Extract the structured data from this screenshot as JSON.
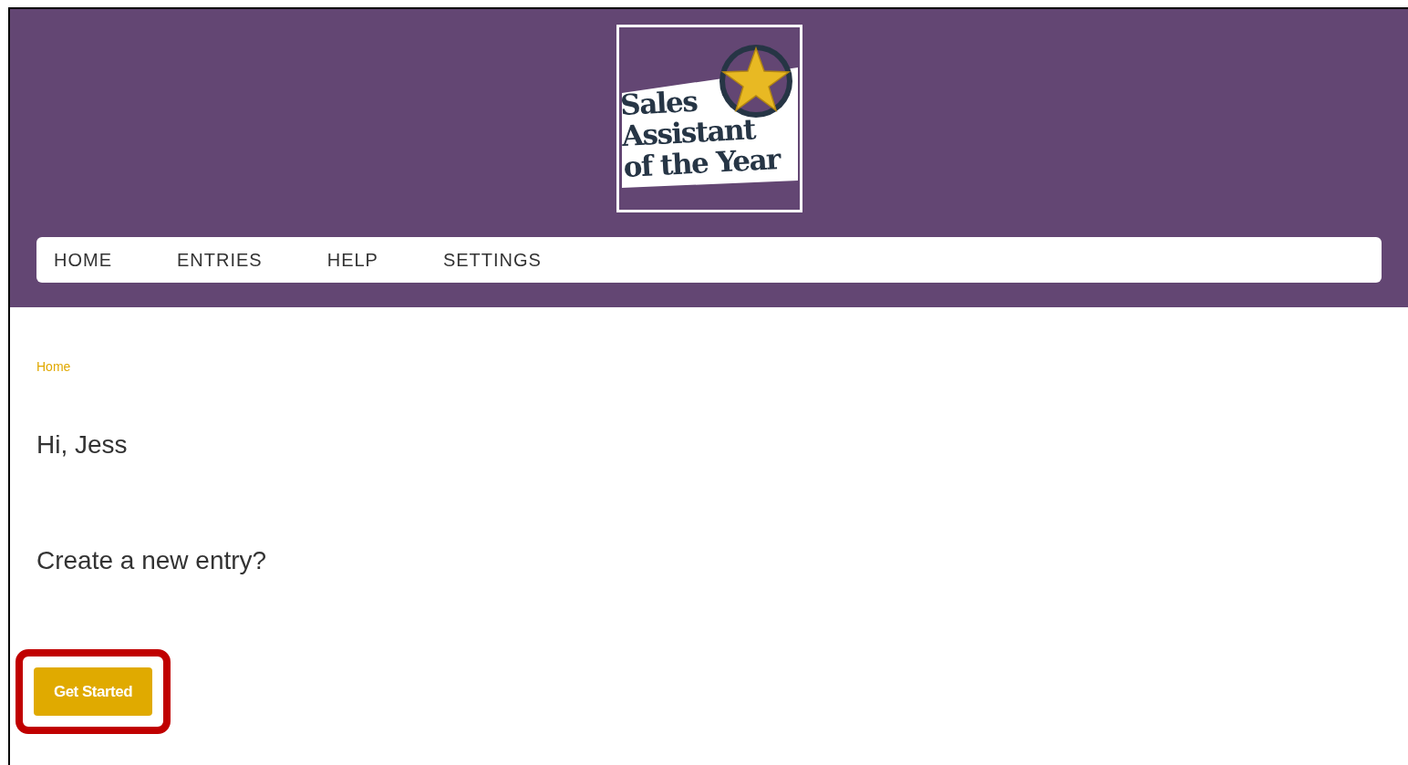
{
  "logo": {
    "lines": [
      "Sales",
      "Assistant",
      "of the Year"
    ]
  },
  "nav": [
    {
      "label": "HOME"
    },
    {
      "label": "ENTRIES"
    },
    {
      "label": "HELP"
    },
    {
      "label": "SETTINGS"
    }
  ],
  "breadcrumb": "Home",
  "greeting": "Hi, Jess",
  "prompt": "Create a new entry?",
  "button": {
    "label": "Get Started",
    "highlighted": true
  }
}
